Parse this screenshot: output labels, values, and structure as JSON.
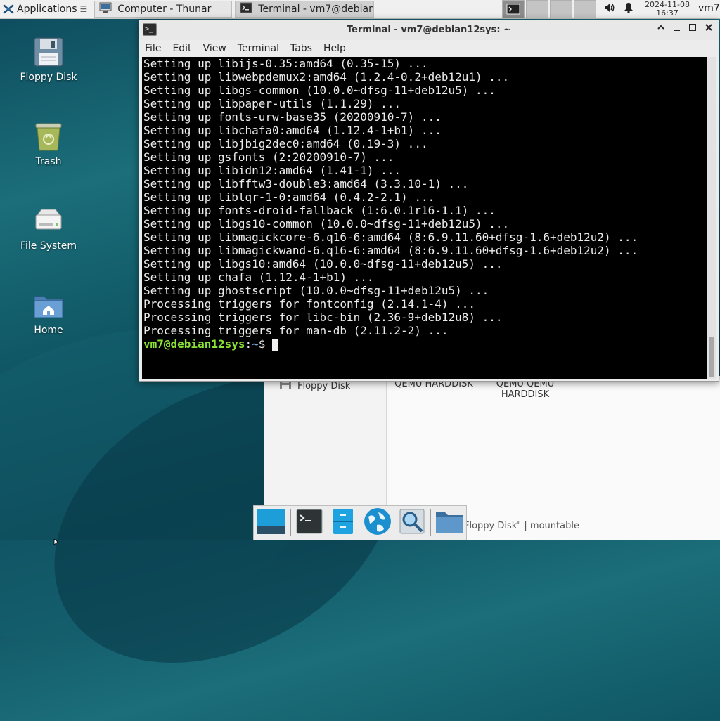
{
  "top_panel": {
    "applications_label": "Applications",
    "tasks": [
      {
        "label": "Computer - Thunar",
        "icon": "file-manager-icon"
      },
      {
        "label": "Terminal - vm7@debian...",
        "icon": "terminal-icon"
      }
    ],
    "clock_date": "2024-11-08",
    "clock_time": "16:37",
    "user": "vm7"
  },
  "desktop": {
    "icons": [
      {
        "label": "Floppy Disk",
        "icon": "floppy-disk-icon"
      },
      {
        "label": "Trash",
        "icon": "trash-icon"
      },
      {
        "label": "File System",
        "icon": "hard-drive-icon"
      },
      {
        "label": "Home",
        "icon": "home-folder-icon"
      }
    ]
  },
  "thunar": {
    "side_item": "Floppy Disk",
    "item1": "QEMU HARDDISK",
    "item2_line1": "QEMU QEMU",
    "item2_line2": "HARDDISK",
    "status": "Floppy Disk\"  |  mountable"
  },
  "terminal": {
    "title": "Terminal - vm7@debian12sys: ~",
    "menu": [
      "File",
      "Edit",
      "View",
      "Terminal",
      "Tabs",
      "Help"
    ],
    "lines": [
      "Setting up libijs-0.35:amd64 (0.35-15) ...",
      "Setting up libwebpdemux2:amd64 (1.2.4-0.2+deb12u1) ...",
      "Setting up libgs-common (10.0.0~dfsg-11+deb12u5) ...",
      "Setting up libpaper-utils (1.1.29) ...",
      "Setting up fonts-urw-base35 (20200910-7) ...",
      "Setting up libchafa0:amd64 (1.12.4-1+b1) ...",
      "Setting up libjbig2dec0:amd64 (0.19-3) ...",
      "Setting up gsfonts (2:20200910-7) ...",
      "Setting up libidn12:amd64 (1.41-1) ...",
      "Setting up libfftw3-double3:amd64 (3.3.10-1) ...",
      "Setting up liblqr-1-0:amd64 (0.4.2-2.1) ...",
      "Setting up fonts-droid-fallback (1:6.0.1r16-1.1) ...",
      "Setting up libgs10-common (10.0.0~dfsg-11+deb12u5) ...",
      "Setting up libmagickcore-6.q16-6:amd64 (8:6.9.11.60+dfsg-1.6+deb12u2) ...",
      "Setting up libmagickwand-6.q16-6:amd64 (8:6.9.11.60+dfsg-1.6+deb12u2) ...",
      "Setting up libgs10:amd64 (10.0.0~dfsg-11+deb12u5) ...",
      "Setting up chafa (1.12.4-1+b1) ...",
      "Setting up ghostscript (10.0.0~dfsg-11+deb12u5) ...",
      "Processing triggers for fontconfig (2.14.1-4) ...",
      "Processing triggers for libc-bin (2.36-9+deb12u8) ...",
      "Processing triggers for man-db (2.11.2-2) ..."
    ],
    "prompt_user": "vm7@debian12sys",
    "prompt_path": "~",
    "prompt_colon": ":",
    "prompt_symbol": "$"
  },
  "dock": {
    "items": [
      "show-desktop-icon",
      "terminal-icon",
      "file-cabinet-icon",
      "web-browser-icon",
      "search-icon",
      "folder-icon"
    ]
  },
  "colors": {
    "prompt_user": "#8ae234",
    "prompt_path": "#729fcf",
    "terminal_bg": "#000000"
  }
}
